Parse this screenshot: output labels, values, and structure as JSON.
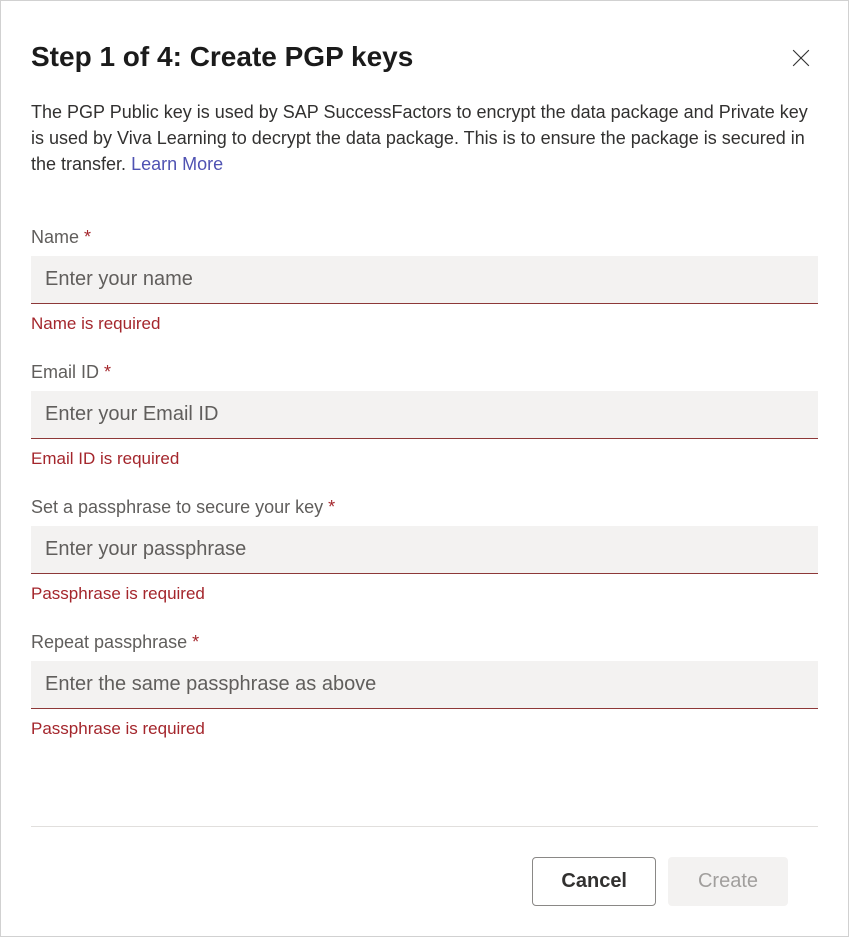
{
  "header": {
    "title": "Step 1 of 4: Create PGP keys"
  },
  "description": {
    "text": "The PGP Public key is used by SAP SuccessFactors to encrypt the data package and Private key is used by Viva Learning to decrypt the data package. This is to ensure the package is secured in the transfer. ",
    "link_text": "Learn More"
  },
  "fields": {
    "name": {
      "label": "Name",
      "placeholder": "Enter your name",
      "error": "Name is required"
    },
    "email": {
      "label": "Email ID",
      "placeholder": "Enter your Email ID",
      "error": "Email ID is required"
    },
    "passphrase": {
      "label": "Set a passphrase to secure your key",
      "placeholder": "Enter your passphrase",
      "error": "Passphrase is required"
    },
    "repeat_passphrase": {
      "label": "Repeat passphrase",
      "placeholder": "Enter the same passphrase as above",
      "error": "Passphrase is required"
    }
  },
  "footer": {
    "cancel_label": "Cancel",
    "create_label": "Create"
  },
  "required_marker": " *"
}
